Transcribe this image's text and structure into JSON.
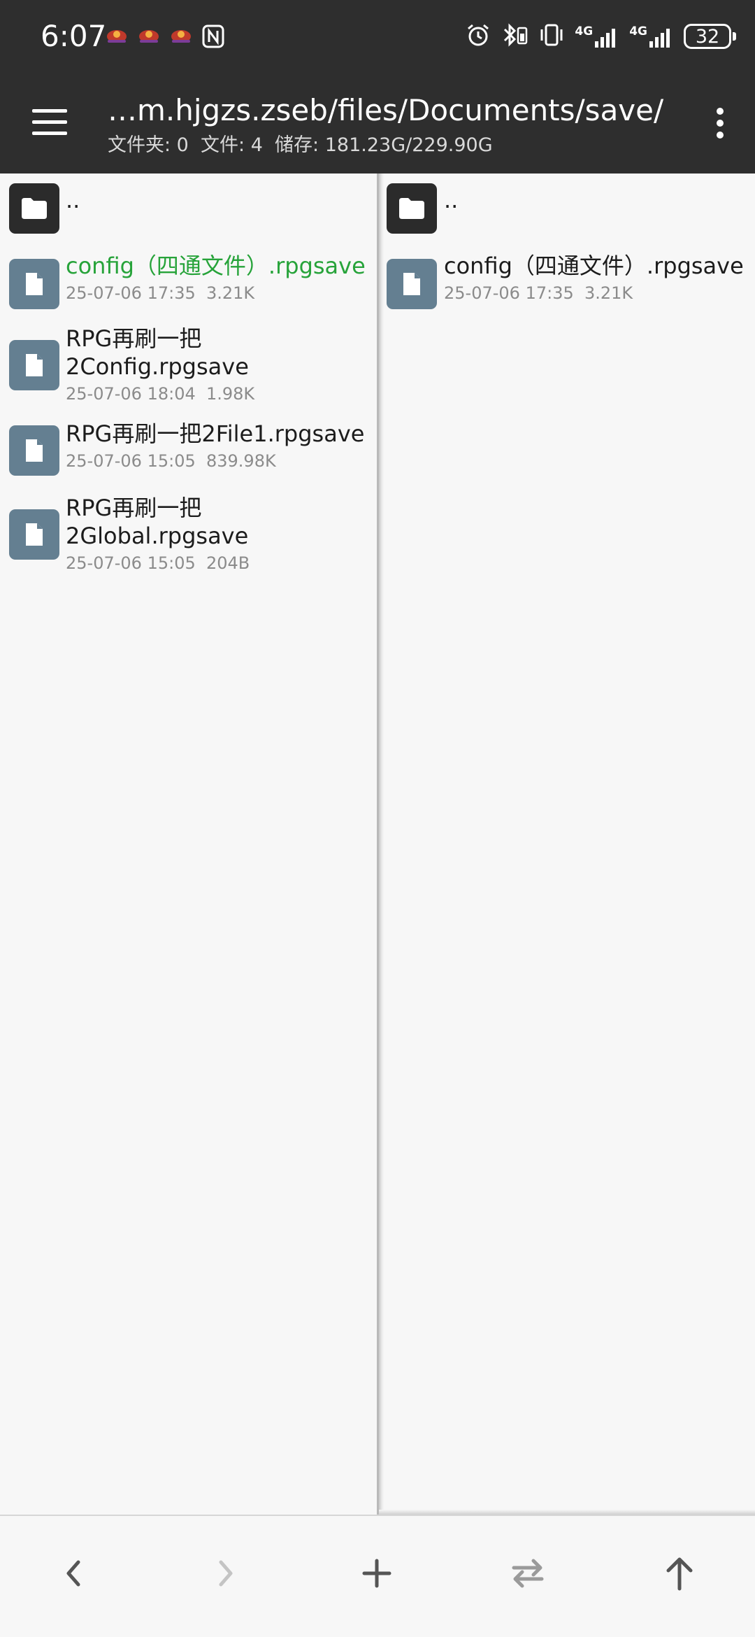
{
  "status_bar": {
    "time": "6:07",
    "battery": "32",
    "network_labels": [
      "4G",
      "4G"
    ],
    "icons": [
      "alarm-icon",
      "bluetooth-icon",
      "vibrate-icon",
      "signal-icon",
      "signal-icon",
      "battery-icon"
    ],
    "notification_icons": [
      "app-notification-icon",
      "app-notification-icon",
      "app-notification-icon",
      "nfc-icon"
    ]
  },
  "app_bar": {
    "path": "…m.hjgzs.zseb/files/Documents/save/",
    "stats": "文件夹: 0  文件: 4  储存: 181.23G/229.90G"
  },
  "left_pane": {
    "parent": "..",
    "files": [
      {
        "name": "config（四通文件）.rpgsave",
        "meta": "25-07-06 17:35  3.21K",
        "selected": true
      },
      {
        "name": "RPG再刷一把2Config.rpgsave",
        "line1": "RPG再刷一把",
        "line2": "2Config.rpgsave",
        "meta": "25-07-06 18:04  1.98K",
        "selected": false
      },
      {
        "name": "RPG再刷一把2File1.rpgsave",
        "meta": "25-07-06 15:05  839.98K",
        "selected": false
      },
      {
        "name": "RPG再刷一把2Global.rpgsave",
        "line1": "RPG再刷一把",
        "line2": "2Global.rpgsave",
        "meta": "25-07-06 15:05  204B",
        "selected": false
      }
    ]
  },
  "right_pane": {
    "parent": "..",
    "files": [
      {
        "name": "config（四通文件）.rpgsave",
        "meta": "25-07-06 17:35  3.21K"
      }
    ]
  },
  "bottom_bar": {
    "buttons": [
      "back-icon",
      "forward-icon",
      "add-icon",
      "swap-icon",
      "up-icon"
    ]
  },
  "colors": {
    "bar_background": "#2e2e2e",
    "selected_text": "#27a33a",
    "file_icon": "#647f91",
    "folder_icon": "#2b2b2b",
    "pane_background": "#f7f7f7"
  }
}
